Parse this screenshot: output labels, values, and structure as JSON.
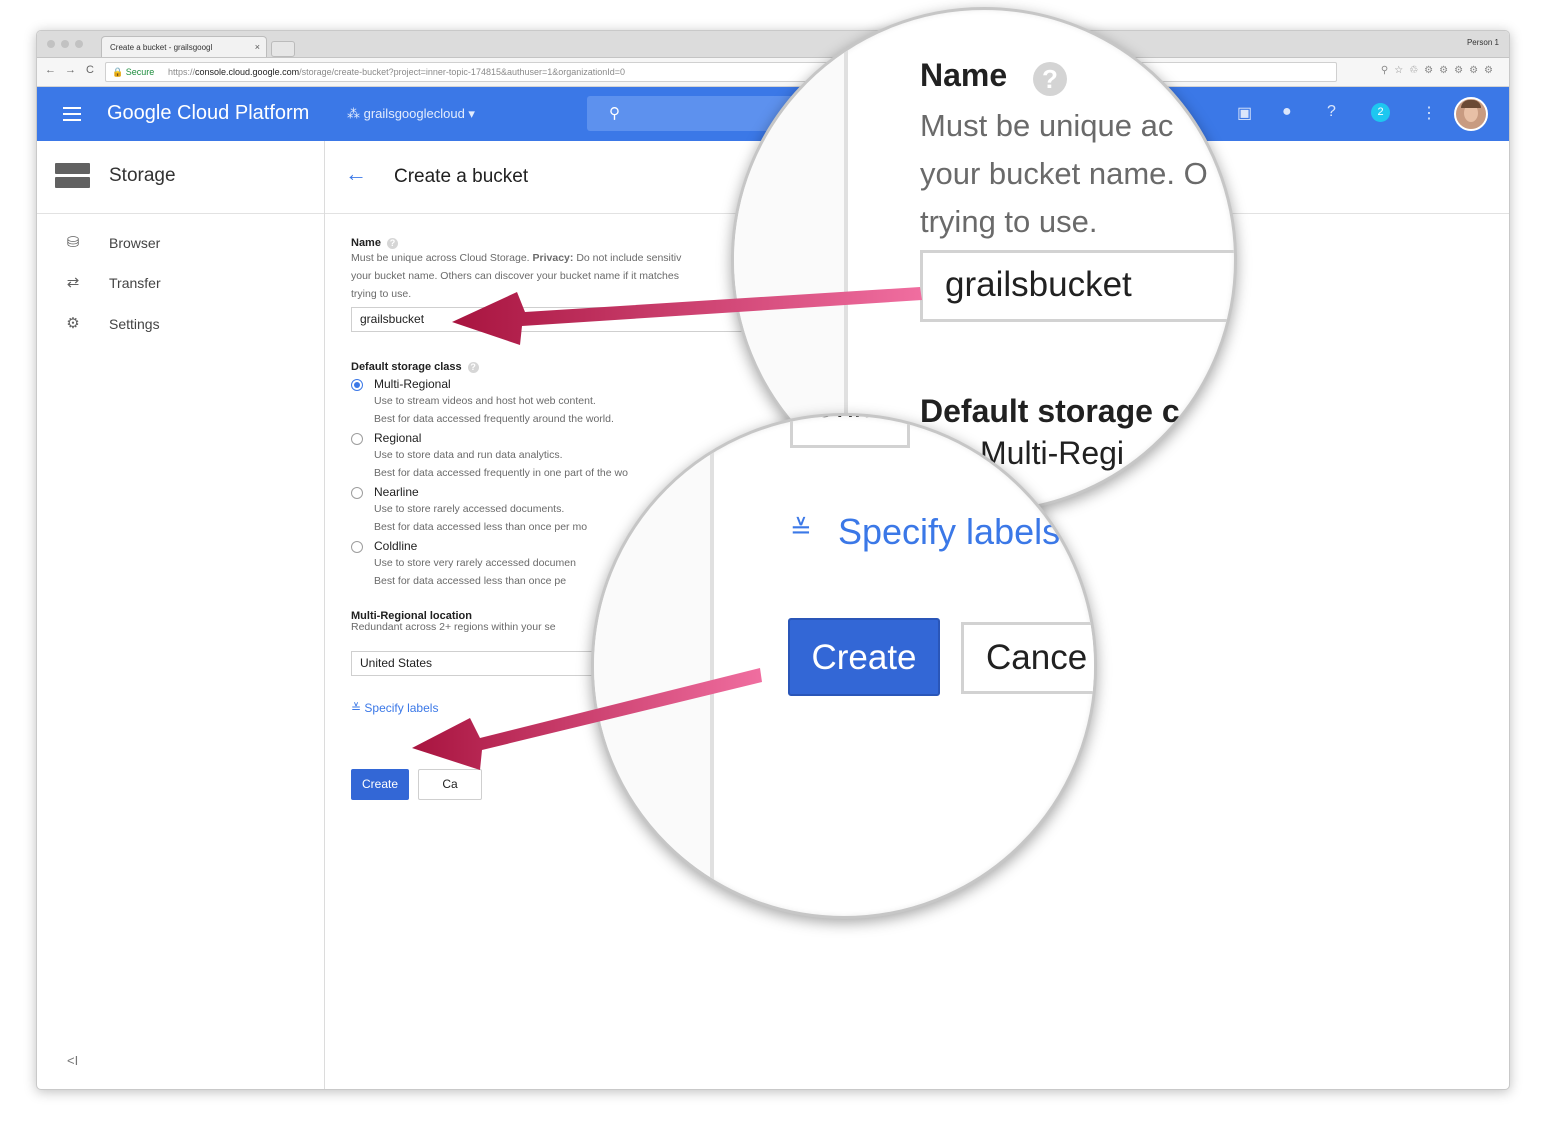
{
  "browser": {
    "tab_title": "Create a bucket - grailsgoogl",
    "tab_close": "×",
    "person": "Person 1",
    "secure_label": "Secure",
    "url_scheme": "https://",
    "url_host": "console.cloud.google.com",
    "url_path": "/storage/create-bucket?project=inner-topic-174815&authuser=1&organizationId=0",
    "nav_back": "←",
    "nav_forward": "→",
    "nav_reload": "C"
  },
  "appbar": {
    "brand": "Google Cloud Platform",
    "project": "grailsgooglecloud",
    "notification_count": "2",
    "accent_color": "#3b78e7"
  },
  "sidenav": {
    "title": "Storage",
    "items": [
      {
        "label": "Browser",
        "icon": "bucket-icon"
      },
      {
        "label": "Transfer",
        "icon": "transfer-icon"
      },
      {
        "label": "Settings",
        "icon": "gear-icon"
      }
    ],
    "collapse": "<I"
  },
  "page": {
    "title": "Create a bucket",
    "name_label": "Name",
    "name_help_1": "Must be unique across Cloud Storage.",
    "name_help_privacy": "Privacy:",
    "name_help_2": "Do not include sensitiv",
    "name_help_3": "your bucket name. Others can discover your bucket name if it matches",
    "name_help_4": "trying to use.",
    "name_value": "grailsbucket",
    "storage_class_label": "Default storage class",
    "storage_classes": [
      {
        "label": "Multi-Regional",
        "desc1": "Use to stream videos and host hot web content.",
        "desc2": "Best for data accessed frequently around the world.",
        "selected": true
      },
      {
        "label": "Regional",
        "desc1": "Use to store data and run data analytics.",
        "desc2": "Best for data accessed frequently in one part of the wo",
        "selected": false
      },
      {
        "label": "Nearline",
        "desc1": "Use to store rarely accessed documents.",
        "desc2": "Best for data accessed less than once per mo",
        "selected": false
      },
      {
        "label": "Coldline",
        "desc1": "Use to store very rarely accessed documen",
        "desc2": "Best for data accessed less than once pe",
        "selected": false
      }
    ],
    "location_label": "Multi-Regional location",
    "location_help": "Redundant across 2+ regions within your se",
    "location_value": "United States",
    "specify_labels": "Specify labels",
    "create": "Create",
    "cancel": "Ca"
  },
  "zoom_top": {
    "name_label": "Name",
    "help_icon": "?",
    "help_line1": "Must be unique ac",
    "help_line2": "your bucket name. O",
    "help_line3": "trying to use.",
    "name_value": "grailsbucket",
    "storage_label": "Default storage c",
    "multi_regional": "Multi-Regi",
    "united_fragment": "Unite"
  },
  "zoom_bottom": {
    "specify_labels": "Specify labels",
    "create": "Create",
    "cancel": "Cance"
  },
  "arrow_color": "#b5174f"
}
